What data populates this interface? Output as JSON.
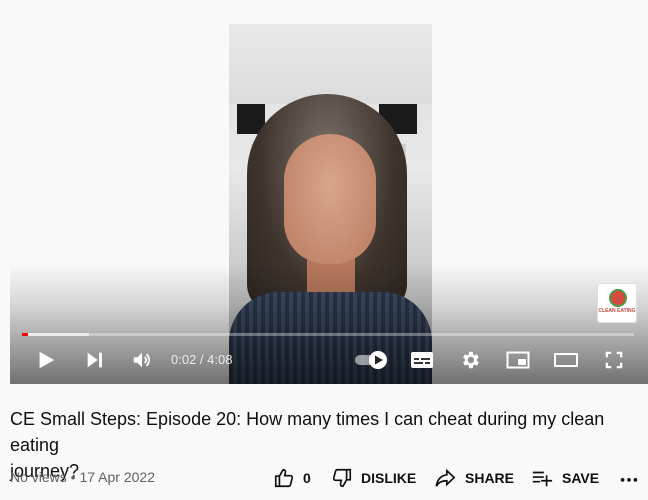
{
  "player": {
    "time_current": "0:02",
    "time_separator": " / ",
    "time_total": "4:08",
    "progress_played_fraction": 0.01,
    "progress_buffered_fraction": 0.11,
    "autoplay_on": true,
    "watermark_text": "CLEAN EATING",
    "colors": {
      "progress": "#ff0000"
    },
    "controls": {
      "play": "play-icon",
      "next": "next-icon",
      "volume": "volume-icon",
      "autoplay": "autoplay-toggle",
      "subtitles": "subtitles-icon",
      "settings": "gear-icon",
      "miniplayer": "miniplayer-icon",
      "theater": "theater-icon",
      "fullscreen": "fullscreen-icon"
    }
  },
  "video": {
    "title": "CE Small Steps: Episode 20: How many times I can cheat during my clean eating\njourney?",
    "views": "No views",
    "separator": " • ",
    "date": "17 Apr 2022"
  },
  "actions": {
    "like_count": "0",
    "dislike_label": "DISLIKE",
    "share_label": "SHARE",
    "save_label": "SAVE",
    "more": "more-icon"
  }
}
